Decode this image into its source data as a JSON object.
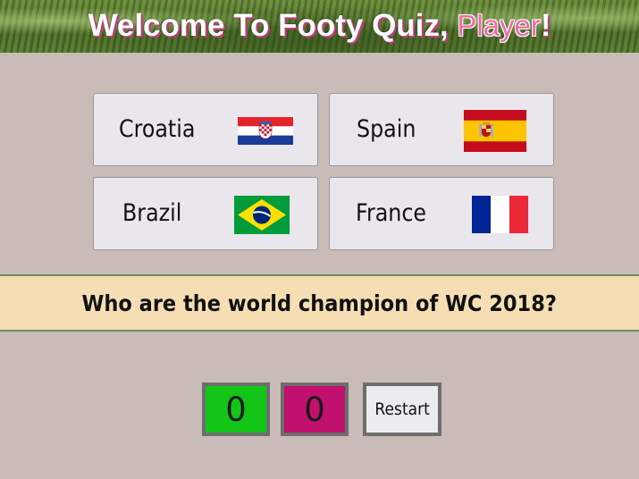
{
  "header": {
    "title_prefix": "Welcome To Footy Quiz, ",
    "player_name": "Player",
    "title_suffix": "!"
  },
  "answers": [
    {
      "label": "Croatia",
      "flag_icon": "croatia-flag-icon"
    },
    {
      "label": "Spain",
      "flag_icon": "spain-flag-icon"
    },
    {
      "label": "Brazil",
      "flag_icon": "brazil-flag-icon"
    },
    {
      "label": "France",
      "flag_icon": "france-flag-icon"
    }
  ],
  "question": "Who are the world champion of WC 2018?",
  "scores": {
    "correct": "0",
    "wrong": "0",
    "correct_color": "#12c516",
    "wrong_color": "#c2106e"
  },
  "controls": {
    "restart_label": "Restart"
  }
}
